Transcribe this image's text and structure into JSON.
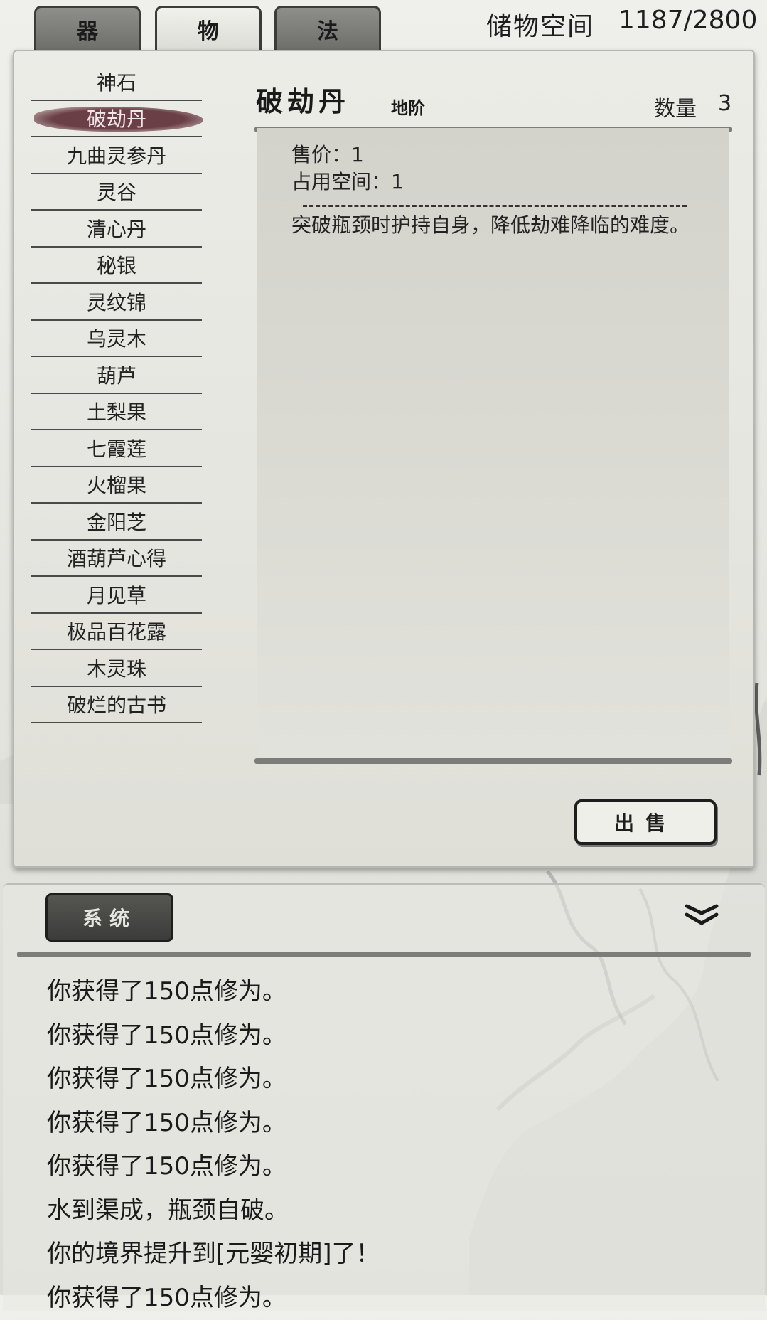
{
  "tabs": [
    {
      "label": "器"
    },
    {
      "label": "物"
    },
    {
      "label": "法"
    }
  ],
  "storage": {
    "label": "储物空间",
    "value": "1187/2800"
  },
  "items": [
    "神石",
    "破劫丹",
    "九曲灵参丹",
    "灵谷",
    "清心丹",
    "秘银",
    "灵纹锦",
    "乌灵木",
    "葫芦",
    "土梨果",
    "七霞莲",
    "火榴果",
    "金阳芝",
    "酒葫芦心得",
    "月见草",
    "极品百花露",
    "木灵珠",
    "破烂的古书"
  ],
  "selected_index": 1,
  "detail": {
    "name": "破劫丹",
    "grade": "地阶",
    "quantity_label": "数量",
    "quantity": "3",
    "price": "售价：1",
    "space": "占用空间：1",
    "description": "突破瓶颈时护持自身，降低劫难降临的难度。"
  },
  "sell_button": "出售",
  "log": {
    "tab_label": "系统",
    "collapse_icon": "double-chevron-down-icon",
    "lines": [
      "你获得了150点修为。",
      "你获得了150点修为。",
      "你获得了150点修为。",
      "你获得了150点修为。",
      "你获得了150点修为。",
      "水到渠成，瓶颈自破。",
      "你的境界提升到[元婴初期]了！",
      "你获得了150点修为。"
    ]
  },
  "colors": {
    "selected_brush": "#6b3f46",
    "panel": "#e9e9e4",
    "bar": "#7c7c78"
  }
}
